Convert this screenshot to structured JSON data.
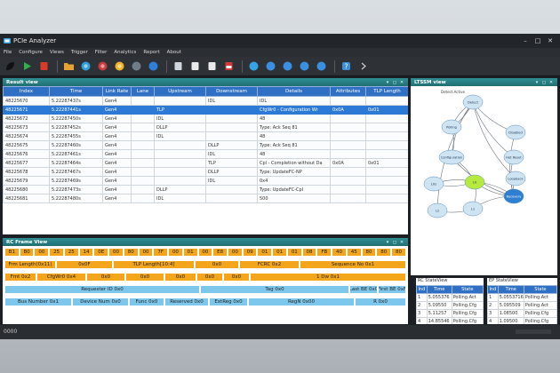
{
  "window": {
    "title": "PCIe Analyzer",
    "controls": [
      "–",
      "□",
      "✕"
    ]
  },
  "menu": [
    "File",
    "Configure",
    "Views",
    "Trigger",
    "Filter",
    "Analytics",
    "Report",
    "About"
  ],
  "toolbar": {
    "buttons": [
      {
        "icon": "dark-leaf-icon",
        "color": "#111111"
      },
      {
        "icon": "play-icon",
        "color": "#2fb24a"
      },
      {
        "icon": "stop-icon",
        "color": "#d93a2b"
      },
      {
        "sep": true
      },
      {
        "icon": "folder-open-icon",
        "color": "#e8a233"
      },
      {
        "icon": "globe-icon",
        "color": "#2e9fd8"
      },
      {
        "icon": "target-icon",
        "color": "#c63b3b"
      },
      {
        "icon": "smiley-icon",
        "color": "#f0b42a"
      },
      {
        "icon": "camera-icon",
        "color": "#6f7d8a"
      },
      {
        "icon": "pause-icon",
        "color": "#2e7fd8"
      },
      {
        "sep": true
      },
      {
        "icon": "save-icon",
        "color": "#cfd6dd"
      },
      {
        "icon": "document-edit-icon",
        "color": "#e9e9e9"
      },
      {
        "icon": "export-icon",
        "color": "#e9e9e9"
      },
      {
        "icon": "pdf-icon",
        "color": "#d33b3b"
      },
      {
        "sep": true
      },
      {
        "icon": "pin-icon",
        "color": "#35a3e6"
      },
      {
        "icon": "search-icon",
        "color": "#3b8fe0"
      },
      {
        "icon": "rewind-icon",
        "color": "#3b8fe0"
      },
      {
        "icon": "forward-icon",
        "color": "#3b8fe0"
      },
      {
        "icon": "skip-icon",
        "color": "#3b8fe0"
      },
      {
        "sep": true
      },
      {
        "icon": "help-icon",
        "color": "#3b8fe0"
      },
      {
        "icon": "more-icon",
        "color": "#cccccc"
      }
    ]
  },
  "result_view": {
    "title": "Result view",
    "columns": [
      "Index",
      "Time",
      "Link Rate",
      "Lane",
      "Upstream",
      "Downstream",
      "Details",
      "Attributes",
      "TLP Length"
    ],
    "rows": [
      [
        "48225670",
        "5.22287437s",
        "Gen4",
        "",
        "",
        "IDL",
        "IDL",
        "",
        ""
      ],
      [
        "48225671",
        "5.22287441s",
        "Gen4",
        "",
        "TLP",
        "",
        "CfgWr0 - Configuration Wr",
        "0x0A",
        "0x01"
      ],
      [
        "48225672",
        "5.22287450s",
        "Gen4",
        "",
        "IDL",
        "",
        "48",
        "",
        ""
      ],
      [
        "48225673",
        "5.22287452s",
        "Gen4",
        "",
        "DLLP",
        "",
        "Type: Ack Seq 81",
        "",
        ""
      ],
      [
        "48225674",
        "5.22287455s",
        "Gen4",
        "",
        "IDL",
        "",
        "48",
        "",
        ""
      ],
      [
        "48225675",
        "5.22287460s",
        "Gen4",
        "",
        "",
        "DLLP",
        "Type: Ack Seq 81",
        "",
        ""
      ],
      [
        "48225676",
        "5.22287461s",
        "Gen4",
        "",
        "",
        "IDL",
        "48",
        "",
        ""
      ],
      [
        "48225677",
        "5.22287464s",
        "Gen4",
        "",
        "",
        "TLP",
        "Cpl - Completion without Da",
        "0x0A",
        "0x01"
      ],
      [
        "48225678",
        "5.22287467s",
        "Gen4",
        "",
        "",
        "DLLP",
        "Type: UpdateFC-NP",
        "",
        ""
      ],
      [
        "48225679",
        "5.22287469s",
        "Gen4",
        "",
        "",
        "IDL",
        "0x4",
        "",
        ""
      ],
      [
        "48225680",
        "5.22287473s",
        "Gen4",
        "",
        "DLLP",
        "",
        "Type: UpdateFC-Cpl",
        "",
        ""
      ],
      [
        "48225681",
        "5.22287480s",
        "Gen4",
        "",
        "IDL",
        "",
        "500",
        "",
        ""
      ]
    ],
    "selected_row": 1
  },
  "ltssm_view": {
    "title": "LTSSM view",
    "caption": "Detect.Active",
    "states": [
      "Detect",
      "Polling",
      "Configuration",
      "L0",
      "Recovery",
      "Disabled",
      "Hot Reset",
      "Loopback",
      "L0s",
      "L1",
      "L2"
    ],
    "active_state": "L0",
    "highlight_state": "Recovery"
  },
  "rc_frame_view": {
    "title": "RC Frame View",
    "bytes": [
      "B1",
      "B0",
      "00",
      "25",
      "25",
      "14",
      "0E",
      "00",
      "80",
      "00",
      "7F",
      "00",
      "01",
      "00",
      "E8",
      "00",
      "09",
      "01",
      "01",
      "01",
      "08",
      "FB",
      "40",
      "45",
      "80",
      "80",
      "80"
    ],
    "rows": [
      [
        [
          "Frm Length(0x11)",
          "o"
        ],
        [
          "0x0F",
          "o"
        ],
        [
          "TLP Length[10:4]",
          "o"
        ],
        [
          "0x0",
          "o"
        ],
        [
          "FCRC 0x2",
          "o"
        ],
        [
          "Sequence No 0x1",
          "o"
        ]
      ],
      [
        [
          "Fmt 0x2",
          "o"
        ],
        [
          "CfgWr0 0x4",
          "o"
        ],
        [
          "0x0",
          "o"
        ],
        [
          "0x0",
          "o"
        ],
        [
          "0x0",
          "o"
        ],
        [
          "0x0",
          "o"
        ],
        [
          "0x0",
          "o"
        ],
        [
          "1 Dw 0x1",
          "o"
        ]
      ],
      [
        [
          "Requester ID 0x0",
          "b"
        ],
        [
          "Tag 0x0",
          "b"
        ],
        [
          "Last BE 0x0",
          "b"
        ],
        [
          "First BE 0xF",
          "b"
        ]
      ],
      [
        [
          "Bus Number 0x1",
          "b"
        ],
        [
          "Device Num 0x0",
          "b"
        ],
        [
          "Func 0x0",
          "b"
        ],
        [
          "Reserved 0x0",
          "b"
        ],
        [
          "ExtReg 0x0",
          "b"
        ],
        [
          "RegN 0x00",
          "b"
        ],
        [
          "R 0x0",
          "b"
        ]
      ]
    ]
  },
  "rc_stateview": {
    "title": "RC StateView",
    "columns": [
      "Ind",
      "Time",
      "State"
    ],
    "rows": [
      [
        "1",
        "5.055376",
        "Polling.Act"
      ],
      [
        "2",
        "5.09550",
        "Polling.Cfg"
      ],
      [
        "3",
        "5.11257",
        "Polling.Cfg"
      ],
      [
        "4",
        "14.85546",
        "Polling.Cfg"
      ],
      [
        "5",
        "15.13571",
        "Polling.Cfg"
      ],
      [
        "6",
        "17.27860",
        "Polling.Cfg"
      ]
    ]
  },
  "ep_stateview": {
    "title": "EP StateView",
    "columns": [
      "Ind",
      "Time",
      "State"
    ],
    "rows": [
      [
        "1",
        "5.0553716",
        "Polling.Act"
      ],
      [
        "2",
        "5.095509",
        "Polling.Act"
      ],
      [
        "3",
        "1.08500",
        "Polling.Cfg"
      ],
      [
        "4",
        "1.09500",
        "Polling.Cfg"
      ],
      [
        "5",
        "3.13550",
        "Polling.Cfg"
      ],
      [
        "6",
        "3.27560",
        "Polling.Cfg"
      ]
    ]
  },
  "statusbar": {
    "text": "0000"
  },
  "colors": {
    "accent": "#2f70c4",
    "panel_header": "#1f6f73",
    "orange": "#f3a51b",
    "blue": "#7ec7ec",
    "selection": "#2d79d6"
  }
}
